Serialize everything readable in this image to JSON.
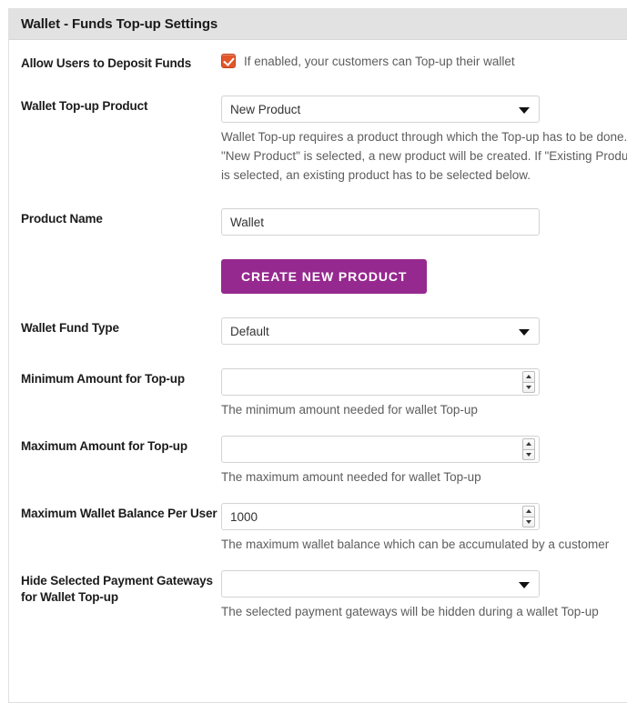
{
  "panel": {
    "title": "Wallet - Funds Top-up Settings"
  },
  "fields": {
    "allow_deposit": {
      "label": "Allow Users to Deposit Funds",
      "checkbox_checked": true,
      "checkbox_color": "#e2562a",
      "description": "If enabled, your customers can Top-up their wallet"
    },
    "topup_product": {
      "label": "Wallet Top-up Product",
      "value": "New Product",
      "hint": "Wallet Top-up requires a product through which the Top-up has to be done. If \"New Product\" is selected, a new product will be created. If \"Existing Product\" is selected, an existing product has to be selected below."
    },
    "product_name": {
      "label": "Product Name",
      "value": "Wallet",
      "placeholder": ""
    },
    "create_product": {
      "label": "CREATE NEW PRODUCT",
      "color": "#96298f"
    },
    "fund_type": {
      "label": "Wallet Fund Type",
      "value": "Default"
    },
    "minimum_amount": {
      "label": "Minimum Amount for Top-up",
      "value": "",
      "hint": "The minimum amount needed for wallet Top-up"
    },
    "maximum_amount": {
      "label": "Maximum Amount for Top-up",
      "value": "",
      "hint": "The maximum amount needed for wallet Top-up"
    },
    "max_balance": {
      "label": "Maximum Wallet Balance Per User",
      "value": "1000",
      "hint": "The maximum wallet balance which can be accumulated by a customer"
    },
    "hide_gateways": {
      "label": "Hide Selected Payment Gateways for Wallet Top-up",
      "value": "",
      "hint": "The selected payment gateways will be hidden during a wallet Top-up"
    }
  }
}
